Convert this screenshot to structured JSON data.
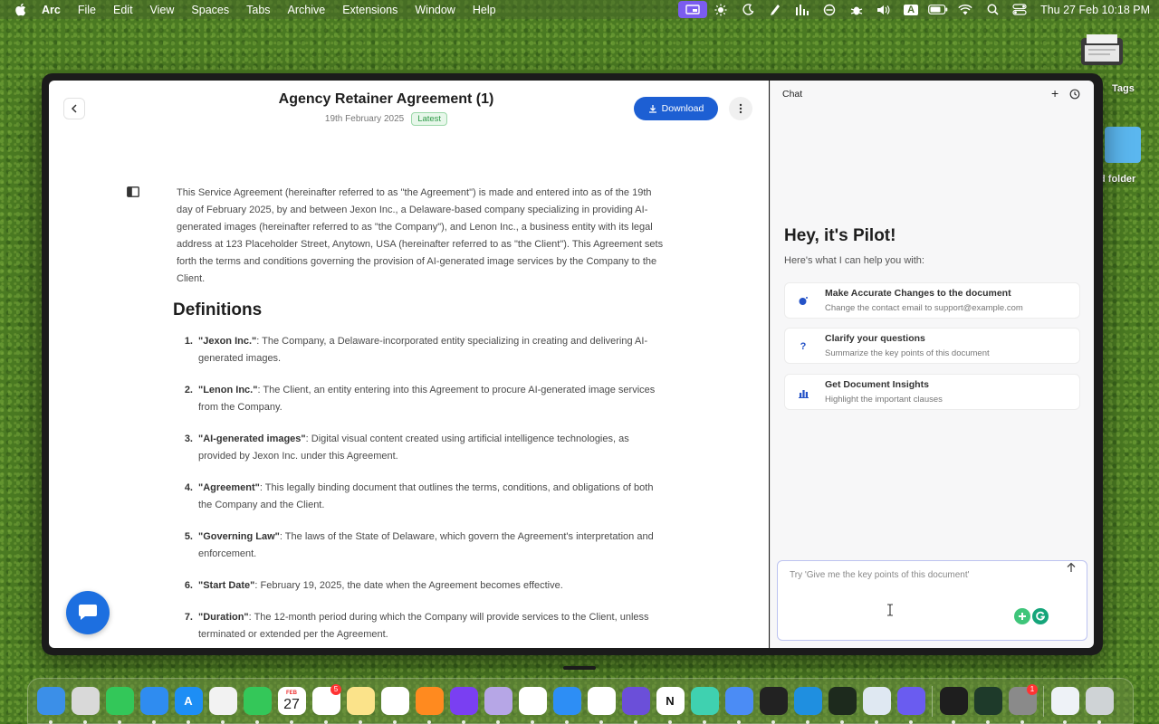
{
  "menubar": {
    "app_name": "Arc",
    "items": [
      "File",
      "Edit",
      "View",
      "Spaces",
      "Tabs",
      "Archive",
      "Extensions",
      "Window",
      "Help"
    ],
    "clock": "Thu 27 Feb  10:18 PM",
    "tray_icons": [
      "screen-share-icon",
      "sun-icon",
      "moon-icon",
      "pen-icon",
      "audio-meter-icon",
      "circle-slash-icon",
      "bug-icon",
      "volume-icon",
      "input-source-icon",
      "battery-icon",
      "wifi-icon",
      "search-icon",
      "control-center-icon"
    ],
    "input_source_label": "A"
  },
  "desktop": {
    "tags_label": "Tags",
    "folder_label": "d folder"
  },
  "document": {
    "title": "Agency Retainer Agreement (1)",
    "date": "19th February 2025",
    "status_badge": "Latest",
    "download_label": "Download",
    "intro": "This Service Agreement (hereinafter referred to as \"the Agreement\") is made and entered into as of the 19th day of February 2025, by and between Jexon Inc., a Delaware-based company specializing in providing AI-generated images (hereinafter referred to as \"the Company\"), and Lenon Inc., a business entity with its legal address at 123 Placeholder Street, Anytown, USA (hereinafter referred to as \"the Client\"). This Agreement sets forth the terms and conditions governing the provision of AI-generated image services by the Company to the Client.",
    "section_heading": "Definitions",
    "definitions": [
      {
        "num": "1.",
        "term": "\"Jexon Inc.\"",
        "text": ": The Company, a Delaware-incorporated entity specializing in creating and delivering AI-generated images."
      },
      {
        "num": "2.",
        "term": "\"Lenon Inc.\"",
        "text": ": The Client, an entity entering into this Agreement to procure AI-generated image services from the Company."
      },
      {
        "num": "3.",
        "term": "\"AI-generated images\"",
        "text": ": Digital visual content created using artificial intelligence technologies, as provided by Jexon Inc. under this Agreement."
      },
      {
        "num": "4.",
        "term": "\"Agreement\"",
        "text": ": This legally binding document that outlines the terms, conditions, and obligations of both the Company and the Client."
      },
      {
        "num": "5.",
        "term": "\"Governing Law\"",
        "text": ": The laws of the State of Delaware, which govern the Agreement's interpretation and enforcement."
      },
      {
        "num": "6.",
        "term": "\"Start Date\"",
        "text": ": February 19, 2025, the date when the Agreement becomes effective."
      },
      {
        "num": "7.",
        "term": "\"Duration\"",
        "text": ": The 12-month period during which the Company will provide services to the Client, unless terminated or extended per the Agreement."
      }
    ]
  },
  "chat": {
    "title": "Chat",
    "new_chat_label": "+",
    "greeting": "Hey, it's Pilot!",
    "subtitle": "Here's what I can help you with:",
    "suggestions": [
      {
        "icon": "lightbulb-icon",
        "title": "Make Accurate Changes to the document",
        "subtitle": "Change the contact email to support@example.com"
      },
      {
        "icon": "question-icon",
        "title": "Clarify your questions",
        "subtitle": "Summarize the key points of this document"
      },
      {
        "icon": "insights-icon",
        "title": "Get Document Insights",
        "subtitle": "Highlight the important clauses"
      }
    ],
    "input_placeholder": "Try 'Give me the key points of this document'",
    "question_glyph": "?"
  },
  "dock": {
    "calendar_month": "FEB",
    "calendar_day": "27",
    "reminders_badge": "5",
    "settings_badge": "1",
    "apps": [
      {
        "name": "finder",
        "color": "#3b8fe8",
        "glyph": ""
      },
      {
        "name": "launchpad",
        "color": "#d9d9d9",
        "glyph": ""
      },
      {
        "name": "messages",
        "color": "#33c759",
        "glyph": ""
      },
      {
        "name": "mail",
        "color": "#2f8cf0",
        "glyph": ""
      },
      {
        "name": "app-store",
        "color": "#1d8ef5",
        "glyph": "A"
      },
      {
        "name": "photos",
        "color": "#f2f2f2",
        "glyph": ""
      },
      {
        "name": "facetime",
        "color": "#34c759",
        "glyph": ""
      },
      {
        "name": "calendar",
        "color": "#ffffff",
        "glyph": ""
      },
      {
        "name": "reminders",
        "color": "#ffffff",
        "glyph": ""
      },
      {
        "name": "notes",
        "color": "#fbe38a",
        "glyph": ""
      },
      {
        "name": "freeform",
        "color": "#ffffff",
        "glyph": ""
      },
      {
        "name": "books",
        "color": "#ff8a1f",
        "glyph": ""
      },
      {
        "name": "firefox",
        "color": "#7a3ff2",
        "glyph": ""
      },
      {
        "name": "affinity",
        "color": "#b6a6e6",
        "glyph": ""
      },
      {
        "name": "chrome",
        "color": "#ffffff",
        "glyph": ""
      },
      {
        "name": "safari",
        "color": "#2d8ef5",
        "glyph": ""
      },
      {
        "name": "mongodb",
        "color": "#ffffff",
        "glyph": ""
      },
      {
        "name": "github",
        "color": "#6b4fd9",
        "glyph": ""
      },
      {
        "name": "notion",
        "color": "#ffffff",
        "glyph": "N"
      },
      {
        "name": "craft",
        "color": "#3fd1b0",
        "glyph": ""
      },
      {
        "name": "arc",
        "color": "#4b8cf5",
        "glyph": ""
      },
      {
        "name": "unity",
        "color": "#222222",
        "glyph": ""
      },
      {
        "name": "vscode",
        "color": "#1f8fe0",
        "glyph": ""
      },
      {
        "name": "terminal-green",
        "color": "#1d2a1d",
        "glyph": ""
      },
      {
        "name": "quicktime",
        "color": "#dfe8f2",
        "glyph": ""
      },
      {
        "name": "perplexity",
        "color": "#6a5cf0",
        "glyph": ""
      },
      {
        "name": "figma",
        "color": "#1e1e1e",
        "glyph": ""
      },
      {
        "name": "activity-monitor",
        "color": "#1e3a2a",
        "glyph": ""
      },
      {
        "name": "system-settings",
        "color": "#8a8a8a",
        "glyph": ""
      },
      {
        "name": "downloads-folder",
        "color": "#eef2f7",
        "glyph": ""
      },
      {
        "name": "trash",
        "color": "#cfd3d6",
        "glyph": ""
      }
    ]
  }
}
